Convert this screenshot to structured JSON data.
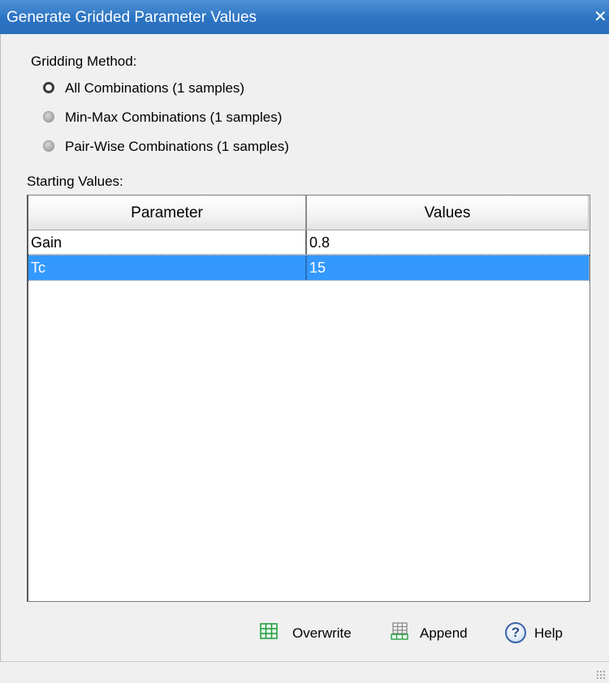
{
  "window": {
    "title": "Generate Gridded Parameter Values",
    "close_glyph": "✕"
  },
  "gridding": {
    "label": "Gridding Method:",
    "options": [
      {
        "label": "All Combinations (1 samples)",
        "selected": true
      },
      {
        "label": "Min-Max Combinations (1 samples)",
        "selected": false
      },
      {
        "label": "Pair-Wise Combinations (1 samples)",
        "selected": false
      }
    ]
  },
  "starting_values": {
    "label": "Starting Values:",
    "columns": [
      "Parameter",
      "Values"
    ],
    "rows": [
      {
        "parameter": "Gain",
        "value": "0.8",
        "selected": false
      },
      {
        "parameter": "Tc",
        "value": "15",
        "selected": true
      }
    ]
  },
  "buttons": {
    "overwrite": "Overwrite",
    "append": "Append",
    "help": "Help",
    "help_glyph": "?"
  },
  "colors": {
    "title_bar": "#2b73c2",
    "selection": "#3399ff",
    "grid_icon": "#1e9a3a"
  }
}
